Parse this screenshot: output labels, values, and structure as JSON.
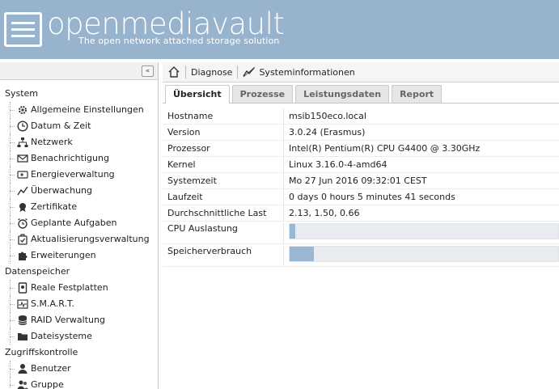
{
  "header": {
    "brand": "openmediavault",
    "tagline": "The open network attached storage solution"
  },
  "sidebar": {
    "collapse_label": "«",
    "groups": [
      {
        "label": "System",
        "items": [
          {
            "label": "Allgemeine Einstellungen",
            "icon": "gear-icon"
          },
          {
            "label": "Datum & Zeit",
            "icon": "clock-icon"
          },
          {
            "label": "Netzwerk",
            "icon": "network-icon"
          },
          {
            "label": "Benachrichtigung",
            "icon": "mail-icon"
          },
          {
            "label": "Energieverwaltung",
            "icon": "power-icon"
          },
          {
            "label": "Überwachung",
            "icon": "chart-line-icon"
          },
          {
            "label": "Zertifikate",
            "icon": "certificate-icon"
          },
          {
            "label": "Geplante Aufgaben",
            "icon": "alarm-clock-icon"
          },
          {
            "label": "Aktualisierungsverwaltung",
            "icon": "update-icon"
          },
          {
            "label": "Erweiterungen",
            "icon": "puzzle-icon"
          }
        ]
      },
      {
        "label": "Datenspeicher",
        "items": [
          {
            "label": "Reale Festplatten",
            "icon": "disk-icon"
          },
          {
            "label": "S.M.A.R.T.",
            "icon": "smart-icon"
          },
          {
            "label": "RAID Verwaltung",
            "icon": "database-icon"
          },
          {
            "label": "Dateisysteme",
            "icon": "folder-icon"
          }
        ]
      },
      {
        "label": "Zugriffskontrolle",
        "items": [
          {
            "label": "Benutzer",
            "icon": "user-icon"
          },
          {
            "label": "Gruppe",
            "icon": "group-icon"
          }
        ]
      }
    ]
  },
  "breadcrumb": {
    "first": "Diagnose",
    "second": "Systeminformationen"
  },
  "tabs": [
    {
      "label": "Übersicht",
      "active": true
    },
    {
      "label": "Prozesse",
      "active": false
    },
    {
      "label": "Leistungsdaten",
      "active": false
    },
    {
      "label": "Report",
      "active": false
    }
  ],
  "properties": [
    {
      "key": "Hostname",
      "value": "msib150eco.local"
    },
    {
      "key": "Version",
      "value": "3.0.24 (Erasmus)"
    },
    {
      "key": "Prozessor",
      "value": "Intel(R) Pentium(R) CPU G4400 @ 3.30GHz"
    },
    {
      "key": "Kernel",
      "value": "Linux 3.16.0-4-amd64"
    },
    {
      "key": "Systemzeit",
      "value": "Mo 27 Jun 2016 09:32:01 CEST"
    },
    {
      "key": "Laufzeit",
      "value": "0 days 0 hours 5 minutes 41 seconds"
    },
    {
      "key": "Durchschnittliche Last",
      "value": "2.13, 1.50, 0.66"
    }
  ],
  "usage": [
    {
      "key": "CPU Auslastung",
      "fraction": 0.02
    },
    {
      "key": "Speicherverbrauch",
      "fraction": 0.09
    }
  ],
  "colors": {
    "header": "#97b3cd",
    "bar_fill": "#9ab7d3"
  }
}
